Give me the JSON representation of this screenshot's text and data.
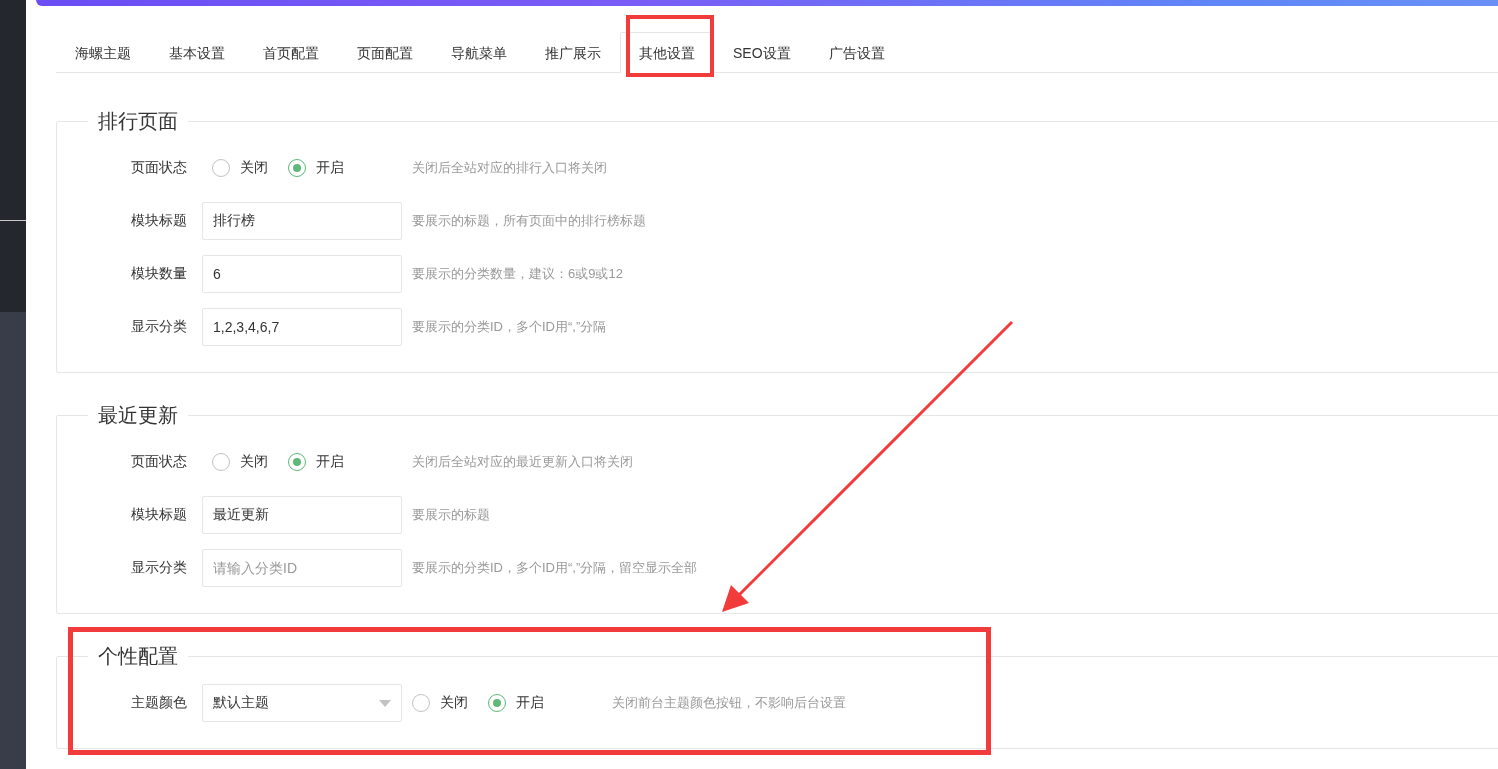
{
  "tabs": [
    {
      "label": "海螺主题",
      "selected": false
    },
    {
      "label": "基本设置",
      "selected": false
    },
    {
      "label": "首页配置",
      "selected": false
    },
    {
      "label": "页面配置",
      "selected": false
    },
    {
      "label": "导航菜单",
      "selected": false
    },
    {
      "label": "推广展示",
      "selected": false
    },
    {
      "label": "其他设置",
      "selected": true
    },
    {
      "label": "SEO设置",
      "selected": false
    },
    {
      "label": "广告设置",
      "selected": false
    }
  ],
  "sections": [
    {
      "title": "排行页面",
      "rows": [
        {
          "kind": "radio",
          "label": "页面状态",
          "options": [
            {
              "label": "关闭",
              "selected": false
            },
            {
              "label": "开启",
              "selected": true
            }
          ],
          "help": "关闭后全站对应的排行入口将关闭"
        },
        {
          "kind": "input",
          "label": "模块标题",
          "value": "排行榜",
          "help": "要展示的标题，所有页面中的排行榜标题"
        },
        {
          "kind": "input",
          "label": "模块数量",
          "value": "6",
          "help": "要展示的分类数量，建议：6或9或12"
        },
        {
          "kind": "input",
          "label": "显示分类",
          "value": "1,2,3,4,6,7",
          "help": "要展示的分类ID，多个ID用“,”分隔"
        }
      ]
    },
    {
      "title": "最近更新",
      "rows": [
        {
          "kind": "radio",
          "label": "页面状态",
          "options": [
            {
              "label": "关闭",
              "selected": false
            },
            {
              "label": "开启",
              "selected": true
            }
          ],
          "help": "关闭后全站对应的最近更新入口将关闭"
        },
        {
          "kind": "input",
          "label": "模块标题",
          "value": "最近更新",
          "help": "要展示的标题"
        },
        {
          "kind": "input",
          "label": "显示分类",
          "placeholder": "请输入分类ID",
          "help": "要展示的分类ID，多个ID用“,”分隔，留空显示全部"
        }
      ]
    },
    {
      "title": "个性配置",
      "rows": [
        {
          "kind": "select_radio",
          "label": "主题颜色",
          "value": "默认主题",
          "options": [
            {
              "label": "关闭",
              "selected": false
            },
            {
              "label": "开启",
              "selected": true
            }
          ],
          "help": "关闭前台主题颜色按钮，不影响后台设置"
        }
      ]
    }
  ]
}
